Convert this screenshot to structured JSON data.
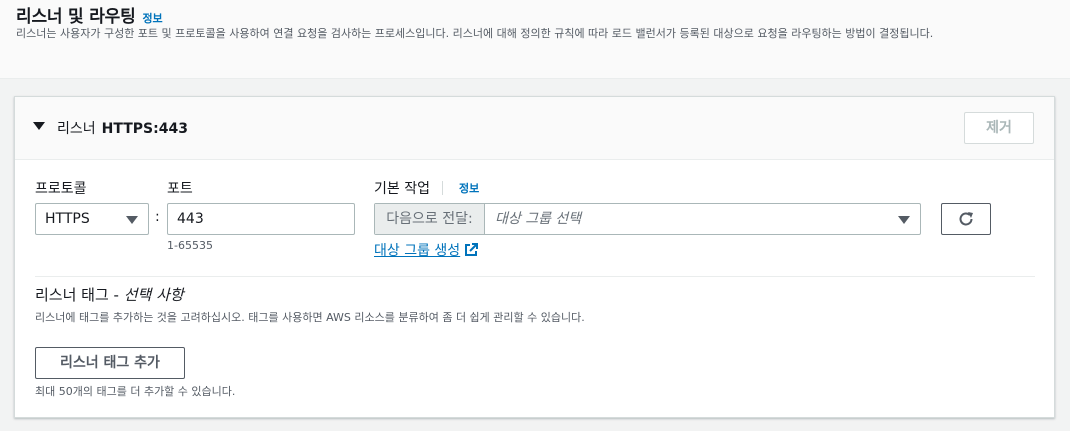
{
  "section": {
    "title": "리스너 및 라우팅",
    "info_label": "정보",
    "description": "리스너는 사용자가 구성한 포트 및 프로토콜을 사용하여 연결 요청을 검사하는 프로세스입니다. 리스너에 대해 정의한 규칙에 따라 로드 밸런서가 등록된 대상으로 요청을 라우팅하는 방법이 결정됩니다."
  },
  "listener": {
    "prefix": "리스너",
    "protocol_port": "HTTPS:443",
    "remove_label": "제거",
    "protocol_label": "프로토콜",
    "protocol_value": "HTTPS",
    "port_label": "포트",
    "port_value": "443",
    "port_hint": "1-65535",
    "default_action_label": "기본 작업",
    "default_action_info": "정보",
    "forward_prefix": "다음으로 전달:",
    "target_group_placeholder": "대상 그룹 선택",
    "create_target_group_label": "대상 그룹 생성"
  },
  "tags": {
    "title_main": "리스너 태그 - ",
    "title_optional": "선택 사항",
    "description": "리스너에 태그를 추가하는 것을 고려하십시오. 태그를 사용하면 AWS 리소스를 분류하여 좀 더 쉽게 관리할 수 있습니다.",
    "add_button_label": "리스너 태그 추가",
    "limit_hint": "최대 50개의 태그를 더 추가할 수 있습니다."
  },
  "colors": {
    "link": "#0073bb",
    "border": "#aab7b8",
    "text": "#16191f",
    "muted": "#545b64"
  }
}
